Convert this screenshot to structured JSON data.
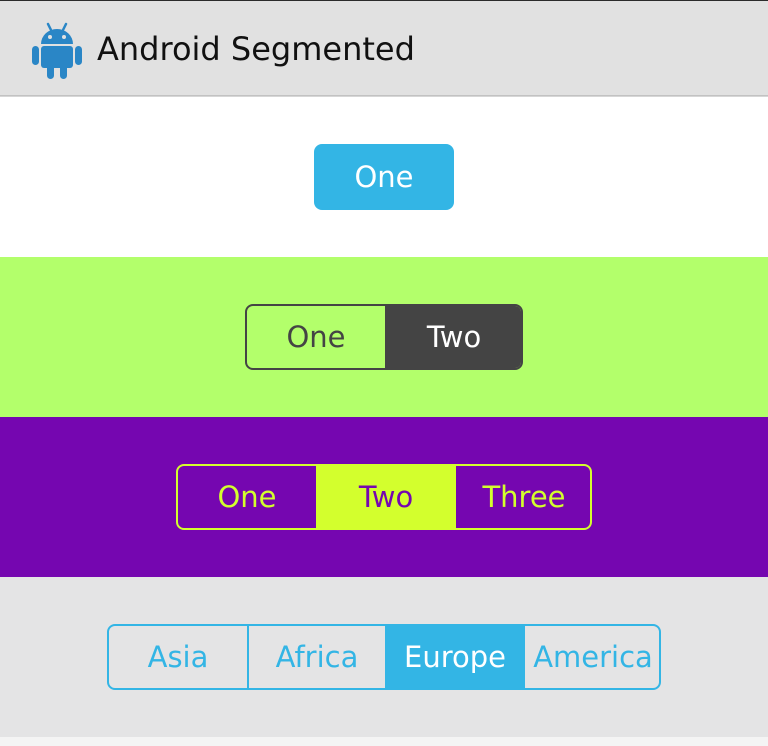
{
  "action_bar": {
    "title": "Android Segmented",
    "icon": "android-robot-icon",
    "background": "#e1e1e1"
  },
  "bands": [
    {
      "background": "#ffffff",
      "accent": "#33b5e5",
      "segments": [
        "One"
      ],
      "selected_index": 0
    },
    {
      "background": "#b3ff6b",
      "accent": "#444444",
      "segments": [
        "One",
        "Two"
      ],
      "selected_index": 1
    },
    {
      "background": "#7506b0",
      "accent": "#d3ff2d",
      "segments": [
        "One",
        "Two",
        "Three"
      ],
      "selected_index": 1
    },
    {
      "background": "#e4e4e5",
      "accent": "#33b5e5",
      "segments": [
        "Asia",
        "Africa",
        "Europe",
        "America"
      ],
      "selected_index": 2
    }
  ]
}
